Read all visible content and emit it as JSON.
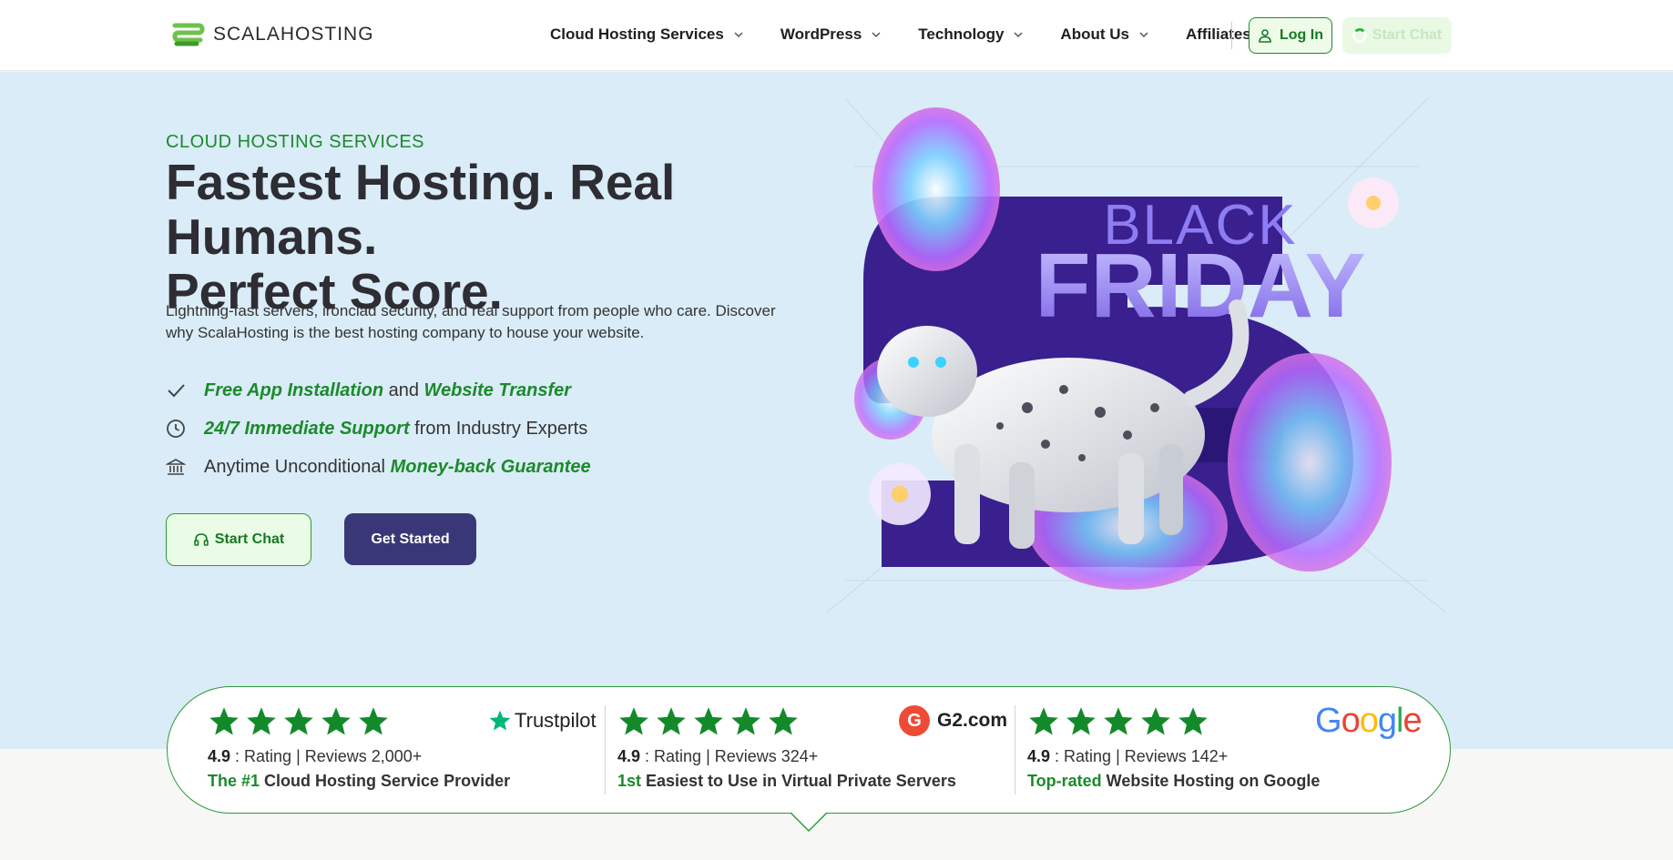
{
  "header": {
    "logo_text": "SCALAHOSTING",
    "nav": [
      {
        "label": "Cloud Hosting Services",
        "has_dropdown": true
      },
      {
        "label": "WordPress",
        "has_dropdown": true
      },
      {
        "label": "Technology",
        "has_dropdown": true
      },
      {
        "label": "About Us",
        "has_dropdown": true
      },
      {
        "label": "Affiliates",
        "has_dropdown": false
      }
    ],
    "login_label": "Log In",
    "chat_label": "Start Chat"
  },
  "hero": {
    "eyebrow": "CLOUD HOSTING SERVICES",
    "headline_line1": "Fastest Hosting. Real Humans.",
    "headline_line2": "Perfect Score.",
    "lead": "Lightning-fast servers, ironclad security, and real support from people who care. Discover why ScalaHosting is the best hosting company to house your website.",
    "features": [
      {
        "icon": "check-icon",
        "em1": "Free App Installation",
        "mid": " and ",
        "em2": "Website Transfer"
      },
      {
        "icon": "clock-icon",
        "em1": "24/7 Immediate Support",
        "rest": " from Industry Experts"
      },
      {
        "icon": "bank-icon",
        "pre": "Anytime Unconditional ",
        "em1": "Money-back Guarantee"
      }
    ],
    "chat_button": "Start Chat",
    "start_button": "Get Started",
    "promo": {
      "line1": "BLACK",
      "line2": "FRIDAY"
    }
  },
  "ratings": [
    {
      "stars": 5,
      "score": "4.9",
      "rest": " : Rating | Reviews 2,000+",
      "highlight": "The #1",
      "desc": " Cloud Hosting Service Provider",
      "brand": "Trustpilot"
    },
    {
      "stars": 5,
      "score": "4.9",
      "rest": " : Rating | Reviews 324+",
      "highlight": "1st",
      "desc": " Easiest to Use in Virtual Private Servers",
      "brand": "G2.com"
    },
    {
      "stars": 5,
      "score": "4.9",
      "rest": " : Rating | Reviews 142+",
      "highlight": "Top-rated",
      "desc": " Website Hosting on Google",
      "brand": "Google"
    }
  ],
  "colors": {
    "accent_green": "#1b8a2b",
    "star_green": "#138a2a",
    "primary_purple": "#3a3779",
    "hero_bg": "#daecf7"
  }
}
